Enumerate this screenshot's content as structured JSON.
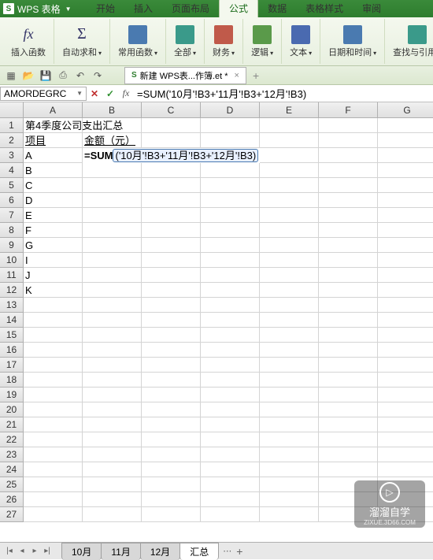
{
  "app": {
    "icon_letter": "S",
    "title": "WPS 表格"
  },
  "menu": {
    "tabs": [
      "开始",
      "插入",
      "页面布局",
      "公式",
      "数据",
      "表格样式",
      "审阅"
    ],
    "active_index": 3
  },
  "ribbon": {
    "insert_fn": "插入函数",
    "autosum": "自动求和",
    "common": "常用函数",
    "all": "全部",
    "finance": "财务",
    "logic": "逻辑",
    "text": "文本",
    "datetime": "日期和时间",
    "lookup": "查找与引用"
  },
  "doc_tab": {
    "label": "新建 WPS表...作簿.et *"
  },
  "formula_bar": {
    "name_box": "AMORDEGRC",
    "formula": "=SUM('10月'!B3+'11月'!B3+'12月'!B3)"
  },
  "grid": {
    "cols": [
      "A",
      "B",
      "C",
      "D",
      "E",
      "F",
      "G"
    ],
    "rows": [
      "1",
      "2",
      "3",
      "4",
      "5",
      "6",
      "7",
      "8",
      "9",
      "10",
      "11",
      "12",
      "13",
      "14",
      "15",
      "16",
      "17",
      "18",
      "19",
      "20",
      "21",
      "22",
      "23",
      "24",
      "25",
      "26",
      "27"
    ],
    "cells": {
      "A1": "第4季度公司支出汇总",
      "A2": "项目",
      "B2": "金额（元）",
      "A3": "A",
      "A4": "B",
      "A5": "C",
      "A6": "D",
      "A7": "E",
      "A8": "F",
      "A9": "G",
      "A10": "I",
      "A11": "J",
      "A12": "K"
    },
    "editing_cell": {
      "prefix": "=SUM",
      "args": "('10月'!B3+'11月'!B3+'12月'!B3)"
    }
  },
  "sheets": {
    "tabs": [
      "10月",
      "11月",
      "12月",
      "汇总"
    ],
    "active_index": 3
  },
  "watermark": {
    "main": "溜溜自学",
    "sub": "ZIXUE.3D66.COM"
  }
}
